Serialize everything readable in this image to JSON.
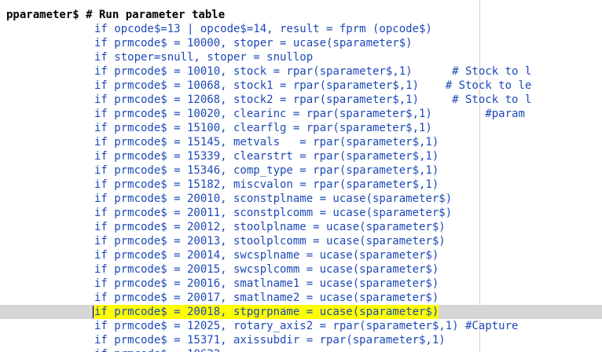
{
  "editor": {
    "header_line": "pparameter$ # Run parameter table",
    "lines": [
      "if opcode$=13 | opcode$=14, result = fprm (opcode$)",
      "if prmcode$ = 10000, stoper = ucase(sparameter$)",
      "if stoper=snull, stoper = snullop",
      "if prmcode$ = 10010, stock = rpar(sparameter$,1)      # Stock to l",
      "if prmcode$ = 10068, stock1 = rpar(sparameter$,1)    # Stock to le",
      "if prmcode$ = 12068, stock2 = rpar(sparameter$,1)     # Stock to l",
      "if prmcode$ = 10020, clearinc = rpar(sparameter$,1)        #param",
      "if prmcode$ = 15100, clearflg = rpar(sparameter$,1)",
      "if prmcode$ = 15145, metvals   = rpar(sparameter$,1)",
      "if prmcode$ = 15339, clearstrt = rpar(sparameter$,1)",
      "if prmcode$ = 15346, comp_type = rpar(sparameter$,1)",
      "if prmcode$ = 15182, miscvalon = rpar(sparameter$,1)",
      "if prmcode$ = 20010, sconstplname = ucase(sparameter$)",
      "if prmcode$ = 20011, sconstplcomm = ucase(sparameter$)",
      "if prmcode$ = 20012, stoolplname = ucase(sparameter$)",
      "if prmcode$ = 20013, stoolplcomm = ucase(sparameter$)",
      "if prmcode$ = 20014, swcsplname = ucase(sparameter$)",
      "if prmcode$ = 20015, swcsplcomm = ucase(sparameter$)",
      "if prmcode$ = 20016, smatlname1 = ucase(sparameter$)",
      "if prmcode$ = 20017, smatlname2 = ucase(sparameter$)",
      "if prmcode$ = 20018, stpgrpname = ucase(sparameter$)",
      "if prmcode$ = 12025, rotary_axis2 = rpar(sparameter$,1) #Capture",
      "if prmcode$ = 15371, axissubdir = rpar(sparameter$,1)",
      "if prmcode$ = 10622"
    ],
    "highlighted_line_index": 20
  }
}
